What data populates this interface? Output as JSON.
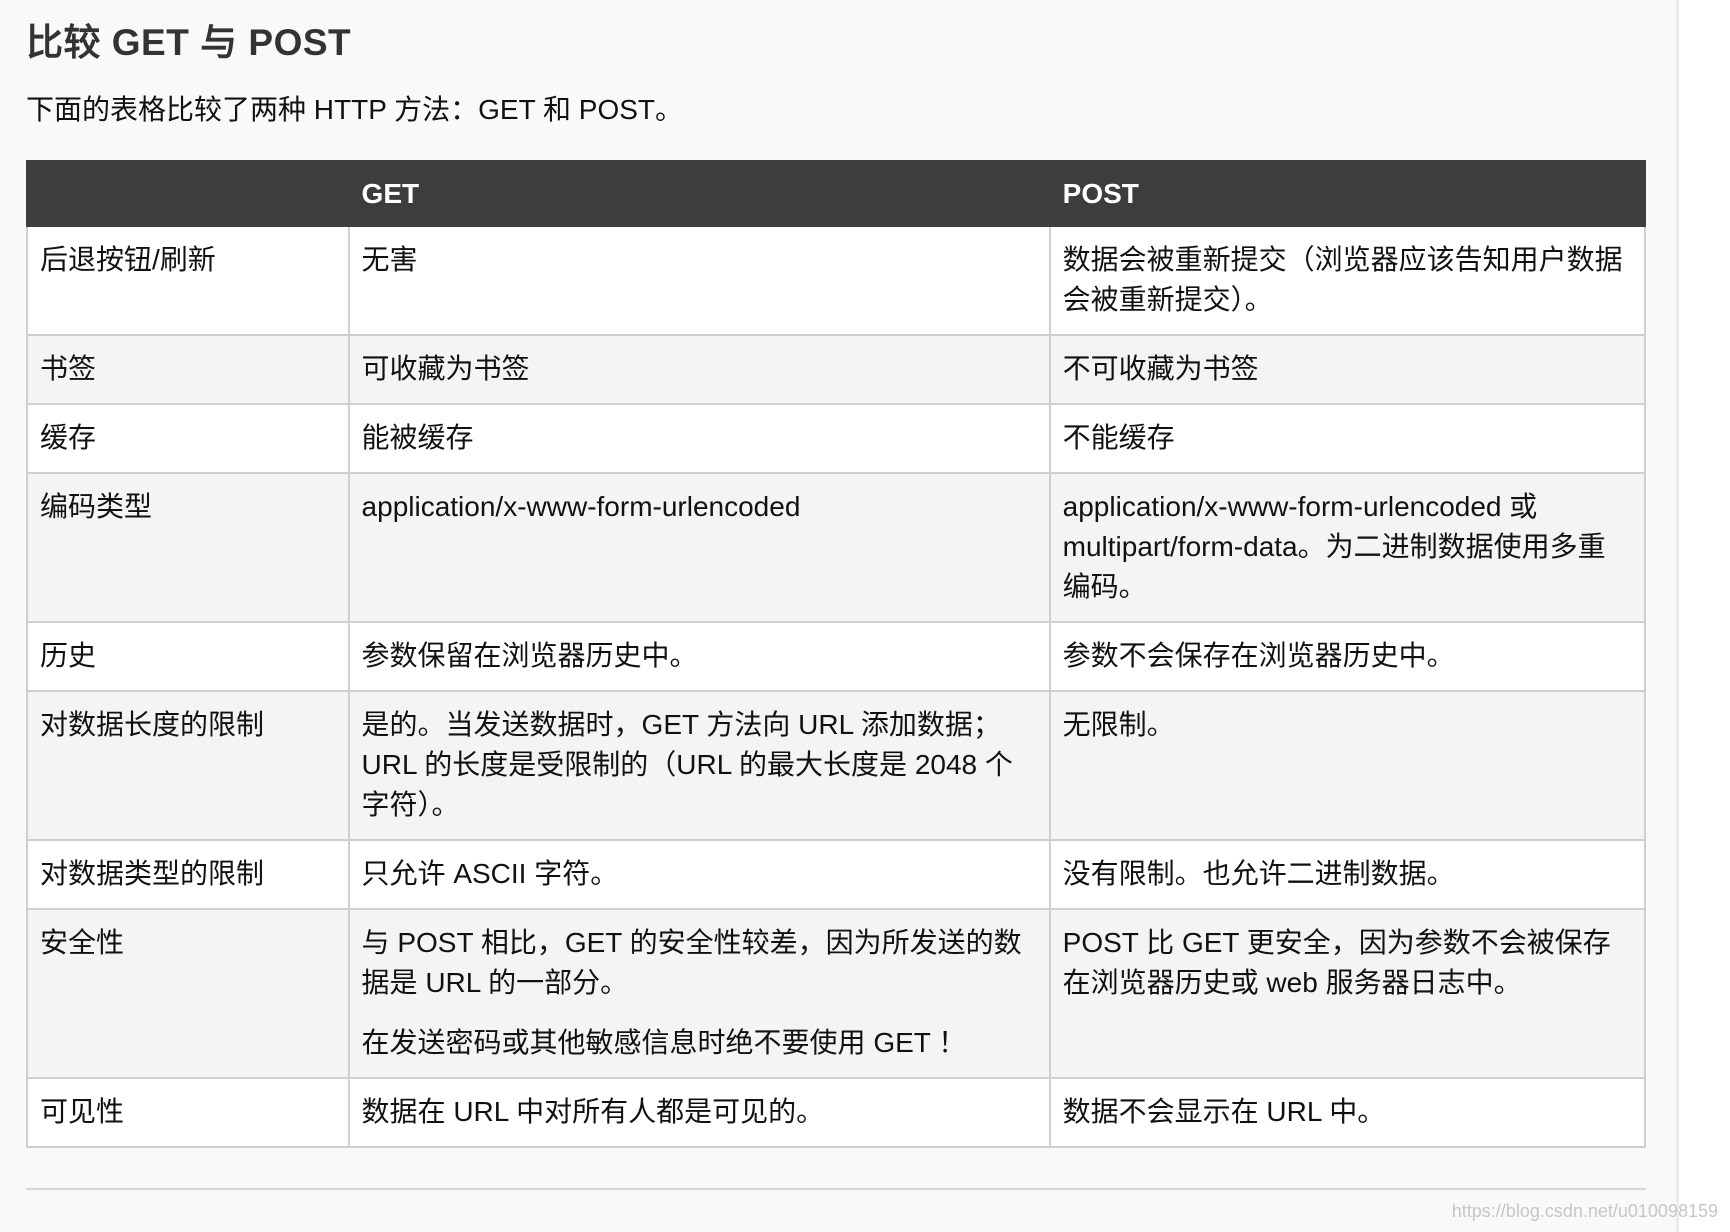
{
  "page": {
    "title": "比较 GET 与 POST",
    "intro": "下面的表格比较了两种 HTTP 方法：GET 和 POST。"
  },
  "table": {
    "headers": [
      "",
      "GET",
      "POST"
    ],
    "rows": [
      {
        "label": "后退按钮/刷新",
        "get": [
          "无害"
        ],
        "post": [
          "数据会被重新提交（浏览器应该告知用户数据会被重新提交）。"
        ]
      },
      {
        "label": "书签",
        "get": [
          "可收藏为书签"
        ],
        "post": [
          "不可收藏为书签"
        ]
      },
      {
        "label": "缓存",
        "get": [
          "能被缓存"
        ],
        "post": [
          "不能缓存"
        ]
      },
      {
        "label": "编码类型",
        "get": [
          "application/x-www-form-urlencoded"
        ],
        "post": [
          "application/x-www-form-urlencoded 或 multipart/form-data。为二进制数据使用多重编码。"
        ]
      },
      {
        "label": "历史",
        "get": [
          "参数保留在浏览器历史中。"
        ],
        "post": [
          "参数不会保存在浏览器历史中。"
        ]
      },
      {
        "label": "对数据长度的限制",
        "get": [
          "是的。当发送数据时，GET 方法向 URL 添加数据；URL 的长度是受限制的（URL 的最大长度是 2048 个字符）。"
        ],
        "post": [
          "无限制。"
        ]
      },
      {
        "label": "对数据类型的限制",
        "get": [
          "只允许 ASCII 字符。"
        ],
        "post": [
          "没有限制。也允许二进制数据。"
        ]
      },
      {
        "label": "安全性",
        "get": [
          "与 POST 相比，GET 的安全性较差，因为所发送的数据是 URL 的一部分。",
          "在发送密码或其他敏感信息时绝不要使用 GET ！"
        ],
        "post": [
          "POST 比 GET 更安全，因为参数不会被保存在浏览器历史或 web 服务器日志中。"
        ]
      },
      {
        "label": "可见性",
        "get": [
          "数据在 URL 中对所有人都是可见的。"
        ],
        "post": [
          "数据不会显示在 URL 中。"
        ]
      }
    ]
  },
  "watermark": "https://blog.csdn.net/u010098159"
}
